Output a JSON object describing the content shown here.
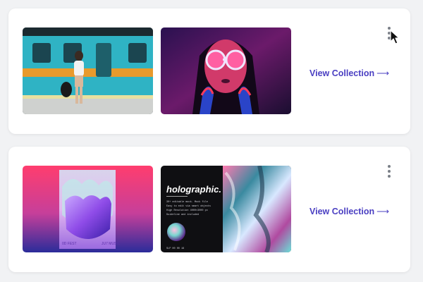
{
  "collections": [
    {
      "link_label": "View Collection",
      "link_arrow": "⟶",
      "thumbnails": [
        {
          "icon": "subway-woman-photo"
        },
        {
          "icon": "neon-portrait-photo"
        }
      ]
    },
    {
      "link_label": "View Collection",
      "link_arrow": "⟶",
      "thumbnails": [
        {
          "icon": "holographic-poster"
        },
        {
          "icon": "holographic-flyer",
          "heading": "holographic.",
          "body_lines": [
            "30+ editable mock. Mock file",
            "Easy to edit via smart objects",
            "High Resolution 4000×3000 px",
            "Guideline and included"
          ],
          "footer": "SLP 00 00 16"
        }
      ]
    }
  ],
  "poster_text": {
    "left": "0D\nFEST",
    "right": "JU7\nMUSIC"
  },
  "more_icon": "vertical-ellipsis-icon",
  "cursor_icon": "mouse-pointer-icon",
  "colors": {
    "link": "#4a3fc2",
    "background": "#f1f2f4",
    "card": "#ffffff"
  }
}
